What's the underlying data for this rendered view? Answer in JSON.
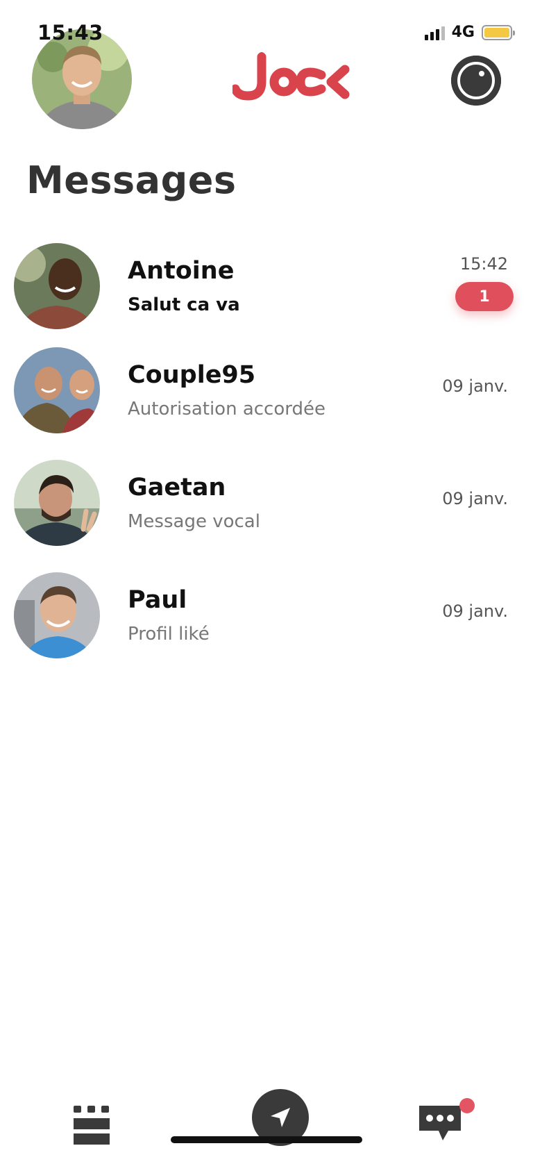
{
  "status_bar": {
    "time": "15:43",
    "network": "4G",
    "battery_color": "#f4c842"
  },
  "header": {
    "logo_text": "jock",
    "logo_color": "#d9444c",
    "profile_avatar": "user-avatar",
    "action_icon": "camera-icon"
  },
  "page": {
    "title": "Messages"
  },
  "conversations": [
    {
      "name": "Antoine",
      "preview": "Salut ca va",
      "time": "15:42",
      "unread_count": "1",
      "unread": true
    },
    {
      "name": "Couple95",
      "preview": "Autorisation accordée",
      "time": "09 janv.",
      "unread": false
    },
    {
      "name": "Gaetan",
      "preview": "Message vocal",
      "time": "09 janv.",
      "unread": false
    },
    {
      "name": "Paul",
      "preview": "Profil liké",
      "time": "09 janv.",
      "unread": false
    }
  ],
  "bottom_nav": {
    "items": [
      {
        "icon": "grid-icon"
      },
      {
        "icon": "location-arrow-icon"
      },
      {
        "icon": "chat-bubble-icon",
        "has_notification": true
      }
    ],
    "accent_color": "#e35563"
  }
}
